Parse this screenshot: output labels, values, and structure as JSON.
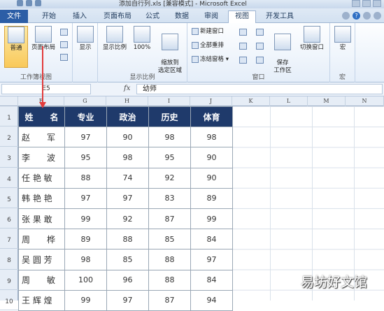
{
  "window": {
    "title": "添加自行列.xls  [兼容模式] - Microsoft Excel"
  },
  "tabs": [
    {
      "label": "文件",
      "active": false
    },
    {
      "label": "开始",
      "active": false
    },
    {
      "label": "插入",
      "active": false
    },
    {
      "label": "页面布局",
      "active": false
    },
    {
      "label": "公式",
      "active": false
    },
    {
      "label": "数据",
      "active": false
    },
    {
      "label": "审阅",
      "active": false
    },
    {
      "label": "视图",
      "active": true
    },
    {
      "label": "开发工具",
      "active": false
    }
  ],
  "ribbon": {
    "workbook_views": {
      "label": "工作簿视图",
      "normal": "普通",
      "page_layout": "页面布局"
    },
    "show": {
      "label": "显示"
    },
    "zoom": {
      "label": "显示比例",
      "zoom": "显示比例",
      "zoom100": "100%",
      "zoom_to_selection": "缩放到\n选定区域"
    },
    "window": {
      "label": "窗口",
      "new_window": "新建窗口",
      "arrange_all": "全部重排",
      "freeze_panes": "冻结窗格",
      "save_workspace": "保存\n工作区",
      "switch_windows": "切换窗口"
    },
    "macros": {
      "label": "宏",
      "macros": "宏"
    }
  },
  "formula_bar": {
    "name_box": "E5",
    "fx": "fx",
    "content": "幼师"
  },
  "columns": [
    "F",
    "G",
    "H",
    "I",
    "J",
    "K",
    "L",
    "M",
    "N"
  ],
  "rows": [
    "1",
    "2",
    "3",
    "4",
    "5",
    "6",
    "7",
    "8",
    "9",
    "10",
    "11"
  ],
  "table": {
    "headers": [
      "姓　　名",
      "专业",
      "政治",
      "历史",
      "体育"
    ],
    "rows": [
      [
        "赵　　军",
        "97",
        "90",
        "98",
        "98"
      ],
      [
        "李　　波",
        "95",
        "98",
        "95",
        "90"
      ],
      [
        "任 艳 敏",
        "88",
        "74",
        "92",
        "90"
      ],
      [
        "韩 艳 艳",
        "97",
        "97",
        "83",
        "89"
      ],
      [
        "张 果 敢",
        "99",
        "92",
        "87",
        "99"
      ],
      [
        "周　　桦",
        "89",
        "88",
        "85",
        "84"
      ],
      [
        "吴 圆 芳",
        "98",
        "85",
        "88",
        "97"
      ],
      [
        "周　　敏",
        "100",
        "96",
        "88",
        "84"
      ],
      [
        "王 辉 煌",
        "99",
        "97",
        "87",
        "94"
      ]
    ]
  },
  "watermark": "易坊好文馆",
  "colors": {
    "header_bg": "#1f3a6b",
    "arrow": "#e23b3b",
    "file_tab": "#2c5ea6"
  }
}
